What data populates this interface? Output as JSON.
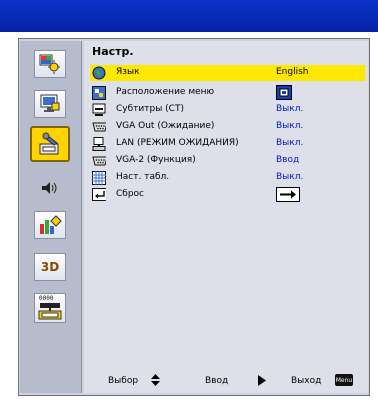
{
  "title": "Настр.",
  "rows": [
    {
      "label": "Язык",
      "value": "English",
      "icon": "globe-icon"
    },
    {
      "label": "Расположение меню",
      "value": "",
      "icon": "menu-position-icon",
      "value_icon": "menu-position-box-icon"
    },
    {
      "label": "Субтитры (СТ)",
      "value": "Выкл.",
      "icon": "captions-icon"
    },
    {
      "label": "VGA Out (Ожидание)",
      "value": "Выкл.",
      "icon": "vga-icon"
    },
    {
      "label": "LAN (РЕЖИМ ОЖИДАНИЯ)",
      "value": "Выкл.",
      "icon": "lan-icon"
    },
    {
      "label": "VGA-2 (Функция)",
      "value": "Ввод",
      "icon": "vga2-icon"
    },
    {
      "label": "Наст. табл.",
      "value": "Выкл.",
      "icon": "test-pattern-icon"
    },
    {
      "label": "Сброс",
      "value": "",
      "icon": "enter-icon",
      "value_icon": "arrow-right-box-icon"
    }
  ],
  "footer": {
    "select": "Выбор",
    "enter": "Ввод",
    "exit": "Выход",
    "menu_key": "Menu"
  },
  "sidebar_text": {
    "three_d": "3D",
    "lan_digits": "0000"
  },
  "colors": {
    "top_bar": "#0a2bbf",
    "highlight": "#ffe800",
    "value_text": "#0018c8",
    "active_tab": "#ffd400"
  }
}
